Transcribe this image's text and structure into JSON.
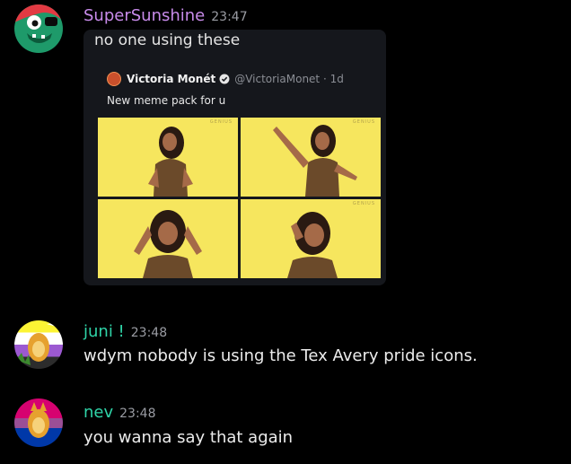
{
  "messages": [
    {
      "username": "SuperSunshine",
      "username_color": "#c88bea",
      "timestamp": "23:47",
      "attachment": {
        "caption": "no one using these",
        "tweet": {
          "name": "Victoria Monét",
          "handle": "@VictoriaMonet · 1d",
          "text": "New meme pack for u"
        },
        "watermark": "GENIUS"
      }
    },
    {
      "username": "juni !",
      "username_color": "#2fd4a8",
      "timestamp": "23:48",
      "text": "wdym nobody is using the Tex Avery pride icons."
    },
    {
      "username": "nev",
      "username_color": "#2fd4a8",
      "timestamp": "23:48",
      "text": "you wanna say that again"
    }
  ]
}
